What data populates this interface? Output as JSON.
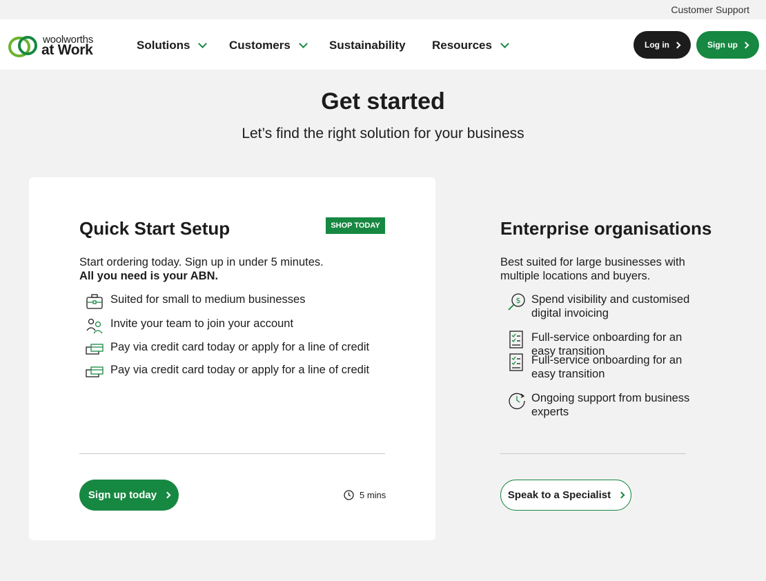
{
  "utility": {
    "support": "Customer Support"
  },
  "brand": {
    "line1": "woolworths",
    "line2": "at Work"
  },
  "nav": {
    "items": [
      {
        "label": "Solutions",
        "dropdown": true
      },
      {
        "label": "Customers",
        "dropdown": true
      },
      {
        "label": "Sustainability",
        "dropdown": false
      },
      {
        "label": "Resources",
        "dropdown": true
      }
    ],
    "login": "Log in",
    "signup": "Sign up"
  },
  "hero": {
    "title": "Get started",
    "subtitle": "Let’s find the right solution for your business"
  },
  "quick": {
    "badge": "SHOP TODAY",
    "title": "Quick Start Setup",
    "desc_line1": "Start ordering today. Sign up in under 5 minutes.",
    "desc_bold": "All you need is your ABN.",
    "features": [
      {
        "icon": "briefcase-icon",
        "text": "Suited for small to medium businesses"
      },
      {
        "icon": "team-icon",
        "text": "Invite your team to join your account"
      },
      {
        "icon": "card-payment-icon",
        "text": "Pay via credit card today or apply for a line of credit"
      },
      {
        "icon": "card-payment-icon",
        "text": "Pay via credit card today or apply for a line of credit"
      }
    ],
    "cta": "Sign up today",
    "time": "5 mins"
  },
  "enterprise": {
    "title": "Enterprise organisations",
    "desc_line1": "Best suited for large businesses with",
    "desc_line2": "multiple locations and buyers.",
    "features": [
      {
        "icon": "dollar-search-icon",
        "line1": "Spend visibility and customised",
        "line2": "digital invoicing"
      },
      {
        "icon": "checklist-icon",
        "line1": "Full-service onboarding for an",
        "line2": "easy transition"
      },
      {
        "icon": "checklist-icon",
        "line1": "Full-service onboarding for an",
        "line2": "easy transition"
      },
      {
        "icon": "clock-support-icon",
        "line1": "Ongoing support from business",
        "line2": "experts"
      }
    ],
    "cta": "Speak to a Specialist"
  },
  "colors": {
    "brand_green": "#178841",
    "dark": "#1c1c1c",
    "background": "#f2f2f2"
  }
}
